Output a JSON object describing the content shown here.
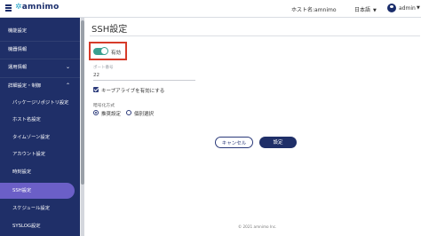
{
  "header": {
    "logo_text": "amnimo",
    "host_label": "ホスト名:amnimo",
    "language": "日本語",
    "user": "admin"
  },
  "sidebar": {
    "items": [
      {
        "label": "機能設定"
      },
      {
        "label": "機器情報"
      },
      {
        "label": "運用情報"
      },
      {
        "label": "詳細設定・制御"
      },
      {
        "label": "パッケージリポジトリ設定"
      },
      {
        "label": "ホスト名設定"
      },
      {
        "label": "タイムゾーン設定"
      },
      {
        "label": "アカウント設定"
      },
      {
        "label": "時刻設定"
      },
      {
        "label": "SSH設定"
      },
      {
        "label": "スケジュール設定"
      },
      {
        "label": "SYSLOG設定"
      }
    ]
  },
  "main": {
    "title": "SSH設定",
    "toggle": {
      "label": "有効",
      "on": true
    },
    "port": {
      "label": "ポート番号",
      "value": "22"
    },
    "keepalive": {
      "label": "キープアライブを有効にする",
      "checked": true
    },
    "encryption": {
      "label": "暗号化方式",
      "options": [
        {
          "label": "推奨設定",
          "selected": true
        },
        {
          "label": "個別選択",
          "selected": false
        }
      ]
    },
    "cancel_label": "キャンセル",
    "submit_label": "設定"
  },
  "footer": {
    "copyright": "© 2021 amnimo Inc."
  },
  "colors": {
    "sidebar_bg": "#1f2f68",
    "active_item": "#6b5fc7",
    "toggle_on": "#3aa090",
    "highlight": "#d63b2a",
    "primary": "#1f2f68"
  }
}
